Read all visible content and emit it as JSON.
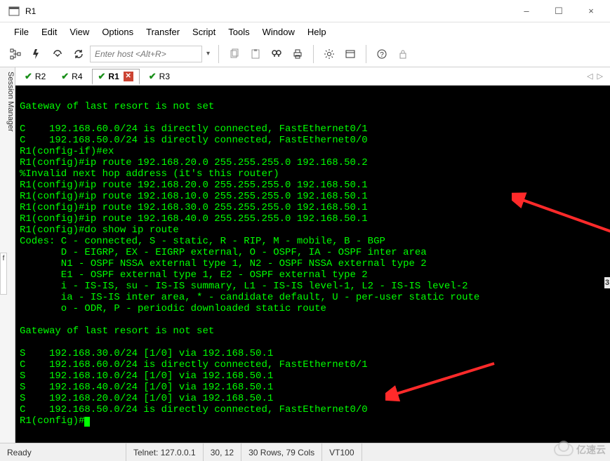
{
  "window": {
    "title": "R1",
    "min_icon": "–",
    "max_icon": "☐",
    "close_icon": "×"
  },
  "menu": {
    "items": [
      "File",
      "Edit",
      "View",
      "Options",
      "Transfer",
      "Script",
      "Tools",
      "Window",
      "Help"
    ]
  },
  "toolbar": {
    "host_placeholder": "Enter host <Alt+R>"
  },
  "session_manager_label": "Session Manager",
  "tabs": {
    "items": [
      {
        "label": "R2",
        "active": false,
        "has_close": false
      },
      {
        "label": "R4",
        "active": false,
        "has_close": false
      },
      {
        "label": "R1",
        "active": true,
        "has_close": true
      },
      {
        "label": "R3",
        "active": false,
        "has_close": false
      }
    ],
    "nav_left": "◁",
    "nav_right": "▷"
  },
  "terminal": {
    "lines": [
      "",
      "Gateway of last resort is not set",
      "",
      "C    192.168.60.0/24 is directly connected, FastEthernet0/1",
      "C    192.168.50.0/24 is directly connected, FastEthernet0/0",
      "R1(config-if)#ex",
      "R1(config)#ip route 192.168.20.0 255.255.255.0 192.168.50.2",
      "%Invalid next hop address (it's this router)",
      "R1(config)#ip route 192.168.20.0 255.255.255.0 192.168.50.1",
      "R1(config)#ip route 192.168.10.0 255.255.255.0 192.168.50.1",
      "R1(config)#ip route 192.168.30.0 255.255.255.0 192.168.50.1",
      "R1(config)#ip route 192.168.40.0 255.255.255.0 192.168.50.1",
      "R1(config)#do show ip route",
      "Codes: C - connected, S - static, R - RIP, M - mobile, B - BGP",
      "       D - EIGRP, EX - EIGRP external, O - OSPF, IA - OSPF inter area",
      "       N1 - OSPF NSSA external type 1, N2 - OSPF NSSA external type 2",
      "       E1 - OSPF external type 1, E2 - OSPF external type 2",
      "       i - IS-IS, su - IS-IS summary, L1 - IS-IS level-1, L2 - IS-IS level-2",
      "       ia - IS-IS inter area, * - candidate default, U - per-user static route",
      "       o - ODR, P - periodic downloaded static route",
      "",
      "Gateway of last resort is not set",
      "",
      "S    192.168.30.0/24 [1/0] via 192.168.50.1",
      "C    192.168.60.0/24 is directly connected, FastEthernet0/1",
      "S    192.168.10.0/24 [1/0] via 192.168.50.1",
      "S    192.168.40.0/24 [1/0] via 192.168.50.1",
      "S    192.168.20.0/24 [1/0] via 192.168.50.1",
      "C    192.168.50.0/24 is directly connected, FastEthernet0/0"
    ],
    "prompt_line": "R1(config)#"
  },
  "status": {
    "ready": "Ready",
    "conn": "Telnet: 127.0.0.1",
    "cursor": "30,  12",
    "size": "30 Rows, 79 Cols",
    "emulation": "VT100"
  },
  "watermark_text": "亿速云",
  "left_decor_text": "f",
  "right_decor_text": "3"
}
